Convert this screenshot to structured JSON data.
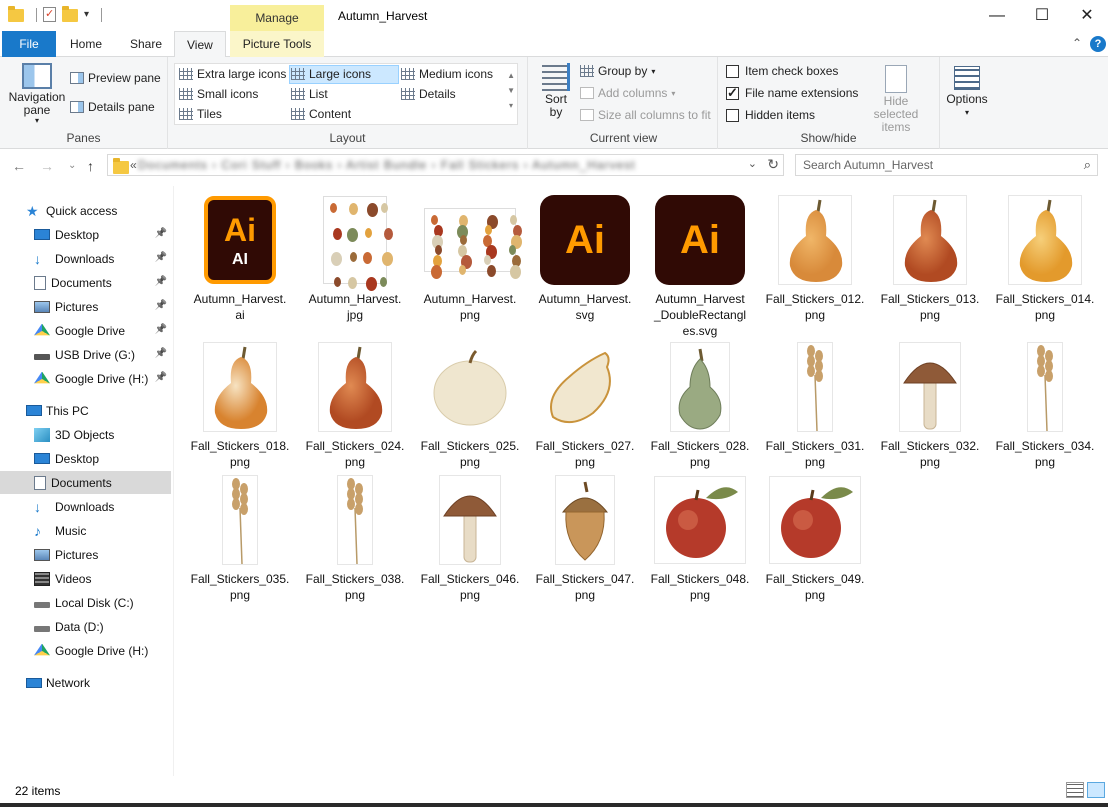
{
  "window": {
    "title": "Autumn_Harvest",
    "context_tab": "Manage",
    "controls": {
      "minimize": "—",
      "maximize": "☐",
      "close": "✕"
    }
  },
  "tabs": {
    "file": "File",
    "home": "Home",
    "share": "Share",
    "view": "View",
    "picture_tools": "Picture Tools"
  },
  "ribbon": {
    "panes": {
      "label": "Panes",
      "navigation_pane": "Navigation pane",
      "preview_pane": "Preview pane",
      "details_pane": "Details pane"
    },
    "layout": {
      "label": "Layout",
      "extra_large_icons": "Extra large icons",
      "large_icons": "Large icons",
      "medium_icons": "Medium icons",
      "small_icons": "Small icons",
      "list": "List",
      "details": "Details",
      "tiles": "Tiles",
      "content": "Content",
      "selected": "Large icons"
    },
    "current_view": {
      "label": "Current view",
      "sort_by": "Sort by",
      "group_by": "Group by",
      "add_columns": "Add columns",
      "size_all_columns": "Size all columns to fit"
    },
    "show_hide": {
      "label": "Show/hide",
      "item_check_boxes": "Item check boxes",
      "item_check_boxes_checked": false,
      "file_name_extensions": "File name extensions",
      "file_name_extensions_checked": true,
      "hidden_items": "Hidden items",
      "hidden_items_checked": false,
      "hide_selected_items": "Hide selected items"
    },
    "options": {
      "label": "Options"
    }
  },
  "address": {
    "overflow": "«",
    "path_blurred": "Documents › Cori Stuff › Books › Artist Bundle › Fall Stickers › Autumn_Harvest",
    "search_placeholder": "Search Autumn_Harvest"
  },
  "sidebar": {
    "quick_access": "Quick access",
    "quick_items": [
      {
        "label": "Desktop",
        "icon": "desktop-icon",
        "pinned": true
      },
      {
        "label": "Downloads",
        "icon": "download-arrow-icon",
        "pinned": true
      },
      {
        "label": "Documents",
        "icon": "document-icon",
        "pinned": true
      },
      {
        "label": "Pictures",
        "icon": "pictures-icon",
        "pinned": true
      },
      {
        "label": "Google Drive",
        "icon": "google-drive-icon",
        "pinned": true
      },
      {
        "label": "USB Drive (G:)",
        "icon": "usb-drive-icon",
        "pinned": true
      },
      {
        "label": "Google Drive (H:)",
        "icon": "google-drive-icon",
        "pinned": true
      }
    ],
    "this_pc": "This PC",
    "pc_items": [
      {
        "label": "3D Objects",
        "icon": "3d-objects-icon"
      },
      {
        "label": "Desktop",
        "icon": "desktop-icon"
      },
      {
        "label": "Documents",
        "icon": "document-icon",
        "selected": true
      },
      {
        "label": "Downloads",
        "icon": "download-arrow-icon"
      },
      {
        "label": "Music",
        "icon": "music-note-icon"
      },
      {
        "label": "Pictures",
        "icon": "pictures-icon"
      },
      {
        "label": "Videos",
        "icon": "film-icon"
      },
      {
        "label": "Local Disk (C:)",
        "icon": "windows-disk-icon"
      },
      {
        "label": "Data (D:)",
        "icon": "disk-icon"
      },
      {
        "label": "Google Drive (H:)",
        "icon": "google-drive-icon"
      }
    ],
    "network": "Network"
  },
  "files": [
    {
      "name": "Autumn_Harvest.\nai",
      "kind": "ai-doc"
    },
    {
      "name": "Autumn_Harvest.\njpg",
      "kind": "sheet"
    },
    {
      "name": "Autumn_Harvest.\npng",
      "kind": "sheet-wide"
    },
    {
      "name": "Autumn_Harvest.\nsvg",
      "kind": "ai"
    },
    {
      "name": "Autumn_Harvest\n_DoubleRectangl\nes.svg",
      "kind": "ai"
    },
    {
      "name": "Fall_Stickers_012.\npng",
      "kind": "squash-orange"
    },
    {
      "name": "Fall_Stickers_013.\npng",
      "kind": "squash-red"
    },
    {
      "name": "Fall_Stickers_014.\npng",
      "kind": "squash-yellow"
    },
    {
      "name": "Fall_Stickers_018.\npng",
      "kind": "squash-striped"
    },
    {
      "name": "Fall_Stickers_024.\npng",
      "kind": "squash-red"
    },
    {
      "name": "Fall_Stickers_025.\npng",
      "kind": "pumpkin-white"
    },
    {
      "name": "Fall_Stickers_027.\npng",
      "kind": "gourd-white"
    },
    {
      "name": "Fall_Stickers_028.\npng",
      "kind": "gourd-green"
    },
    {
      "name": "Fall_Stickers_031.\npng",
      "kind": "wheat"
    },
    {
      "name": "Fall_Stickers_032.\npng",
      "kind": "mushroom"
    },
    {
      "name": "Fall_Stickers_034.\npng",
      "kind": "wheat"
    },
    {
      "name": "Fall_Stickers_035.\npng",
      "kind": "wheat"
    },
    {
      "name": "Fall_Stickers_038.\npng",
      "kind": "wheat"
    },
    {
      "name": "Fall_Stickers_046.\npng",
      "kind": "mushroom"
    },
    {
      "name": "Fall_Stickers_047.\npng",
      "kind": "acorn"
    },
    {
      "name": "Fall_Stickers_048.\npng",
      "kind": "apple"
    },
    {
      "name": "Fall_Stickers_049.\npng",
      "kind": "apple"
    }
  ],
  "ai_text": {
    "mark": "Ai",
    "sub": "AI"
  },
  "status": {
    "item_count": "22 items"
  },
  "colors": {
    "accent": "#1979ca",
    "ai_bg": "#300a05",
    "ai_orange": "#ff9a00",
    "manage": "#f8ef9b"
  }
}
